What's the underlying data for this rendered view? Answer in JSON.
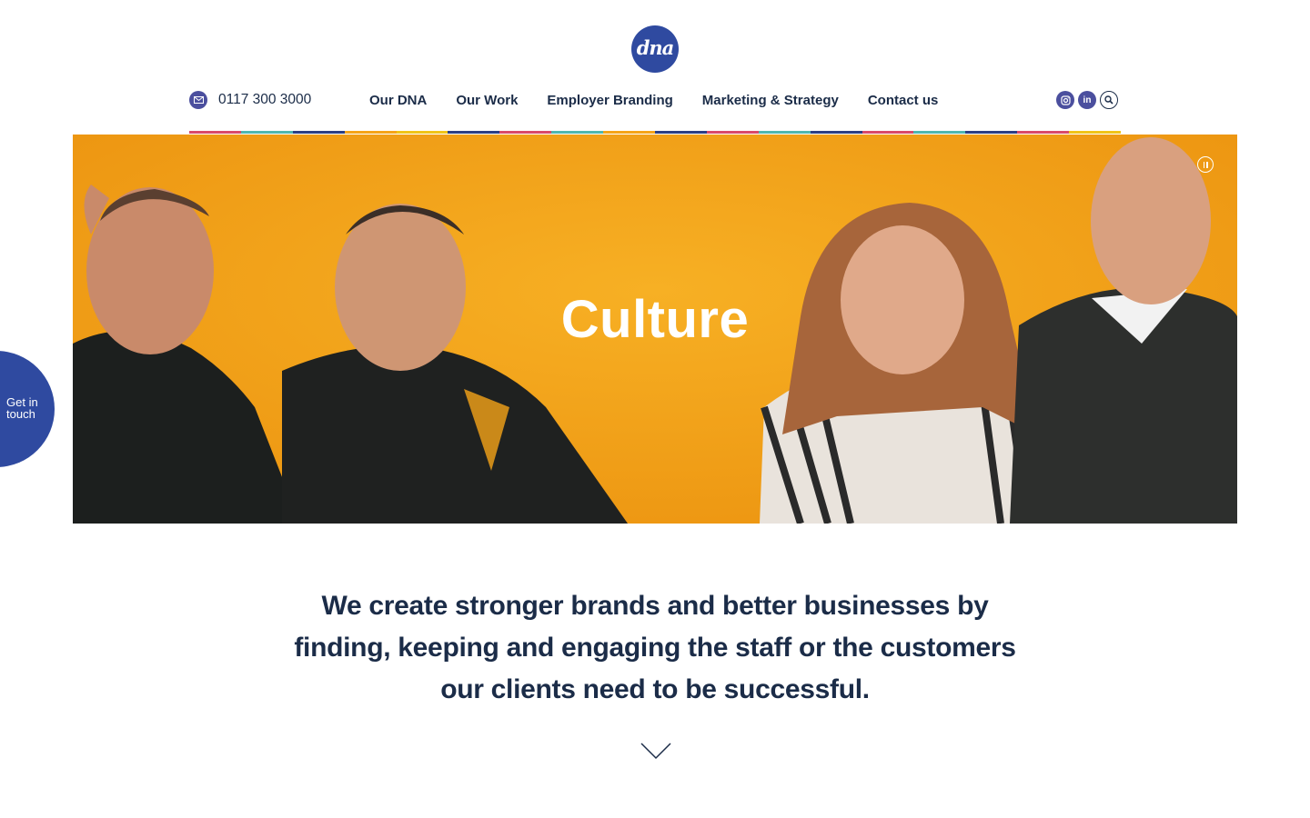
{
  "logo": {
    "text": "dna"
  },
  "header": {
    "phone": "0117 300 3000",
    "nav": [
      {
        "label": "Our DNA"
      },
      {
        "label": "Our Work"
      },
      {
        "label": "Employer Branding"
      },
      {
        "label": "Marketing & Strategy"
      },
      {
        "label": "Contact us"
      }
    ],
    "social_icons": [
      "instagram-icon",
      "linkedin-icon",
      "search-icon"
    ],
    "linkedin_glyph": "in"
  },
  "colors": {
    "brand_blue": "#2f4aa0",
    "hero_orange": "#f5a418",
    "text_navy": "#1b2c48",
    "strip": [
      "#d94a6a",
      "#4fb7b0",
      "#2b3f85",
      "#f5a418",
      "#f0c419",
      "#2b3f85",
      "#d94a6a",
      "#4fb7b0",
      "#f5a418",
      "#2b3f85",
      "#d94a6a",
      "#4fb7b0",
      "#2b3f85",
      "#d94a6a",
      "#4fb7b0",
      "#2b3f85",
      "#d94a6a",
      "#f0c419"
    ]
  },
  "hero": {
    "title": "Culture",
    "pause_icon": "pause-icon"
  },
  "get_in_touch": "Get in touch",
  "tagline": "We create stronger brands and better businesses by finding, keeping and engaging the staff or the customers our clients need to be successful.",
  "scroll_icon": "chevron-down-icon"
}
